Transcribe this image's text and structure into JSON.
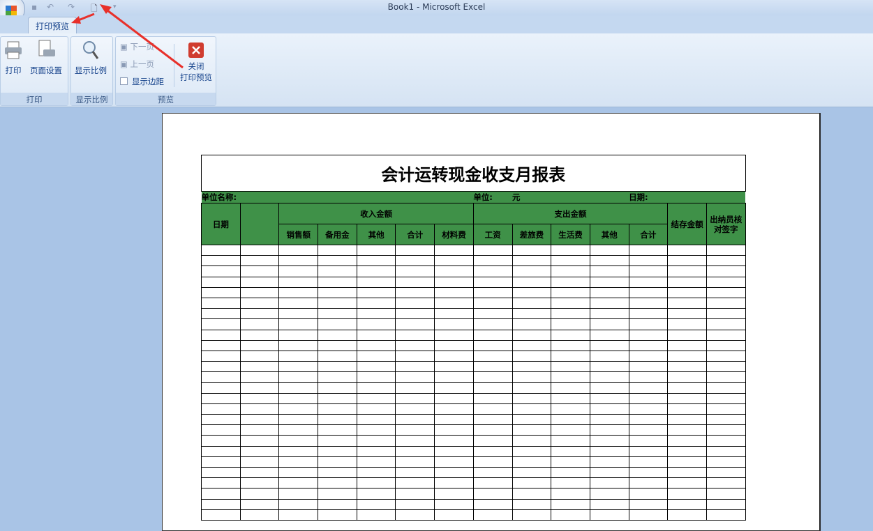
{
  "window": {
    "title": "Book1 - Microsoft Excel"
  },
  "ribbon": {
    "tab": "打印预览",
    "groups": [
      {
        "label": "打印",
        "buttons": [
          "打印",
          "页面设置"
        ]
      },
      {
        "label": "显示比例",
        "buttons": [
          "显示比例"
        ]
      },
      {
        "label": "预览",
        "buttons": [
          "下一页",
          "上一页",
          "显示边距",
          "关闭",
          "打印预览"
        ]
      }
    ]
  },
  "report": {
    "title": "会计运转现金收支月报表",
    "unit_name_label": "单位名称:",
    "unit_label": "单位:",
    "unit_value": "元",
    "date_label": "日期:",
    "headers": {
      "date": "日期",
      "income": "收入金额",
      "expense": "支出金额",
      "balance": "结存金额",
      "cashier": "出纳员核对签字",
      "income_cols": [
        "销售额",
        "备用金",
        "其他",
        "合计",
        "材料费"
      ],
      "expense_cols": [
        "工资",
        "差旅费",
        "生活费",
        "其他",
        "合计"
      ]
    },
    "empty_rows": 26
  },
  "colors": {
    "header_green": "#3f9148",
    "background": "#a9c4e6"
  }
}
